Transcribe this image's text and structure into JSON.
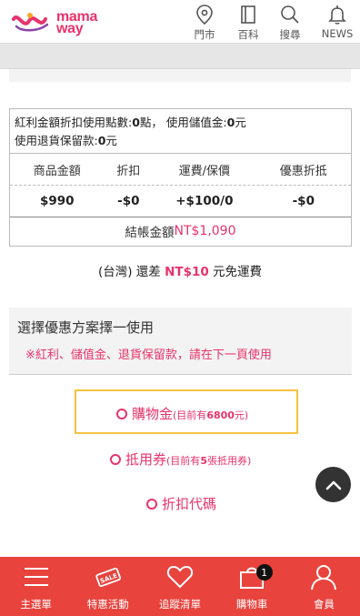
{
  "header": {
    "logo_text_line1": "mama",
    "logo_text_line2": "way",
    "nav": [
      {
        "label": "門市",
        "icon": "location-pin-icon"
      },
      {
        "label": "百科",
        "icon": "book-icon"
      },
      {
        "label": "搜尋",
        "icon": "search-icon"
      },
      {
        "label": "NEWS",
        "icon": "bell-icon"
      }
    ]
  },
  "summary": {
    "points_prefix": "紅利金額折扣使用點數:",
    "points_value": "0",
    "points_unit": "點，",
    "stored_prefix": "使用儲值金:",
    "stored_value": "0",
    "stored_unit": "元",
    "deposit_prefix": "使用退貨保留款:",
    "deposit_value": "0",
    "deposit_unit": "元",
    "columns": [
      "商品金額",
      "折扣",
      "運費/保價",
      "優惠折抵"
    ],
    "values": [
      "$990",
      "-$0",
      "+$100/0",
      "-$0"
    ],
    "total_label": "結帳金額",
    "total_amount": "NT$1,090"
  },
  "free_shipping": {
    "prefix": "(台灣) 還差",
    "amount": "NT$10",
    "suffix": "元免運費"
  },
  "discount": {
    "title": "選擇優惠方案擇一使用",
    "note": "※紅利、儲值金、退貨保留款，請在下一頁使用",
    "options": [
      {
        "label": "購物金",
        "detail_prefix": "(目前有",
        "detail_value": "6800",
        "detail_suffix": "元)"
      },
      {
        "label": "抵用券",
        "detail_prefix": "(目前有",
        "detail_value": "5",
        "detail_suffix": "張抵用券)"
      },
      {
        "label": "折扣代碼"
      }
    ]
  },
  "bottom_nav": [
    {
      "label": "主選單",
      "icon": "menu-icon"
    },
    {
      "label": "特惠活動",
      "icon": "sale-tag-icon"
    },
    {
      "label": "追蹤清單",
      "icon": "heart-icon"
    },
    {
      "label": "購物車",
      "icon": "cart-icon",
      "badge": "1"
    },
    {
      "label": "會員",
      "icon": "user-icon"
    }
  ],
  "colors": {
    "accent": "#e8336b",
    "bottom_bar": "#e8433d",
    "selected_border": "#f5c242"
  }
}
